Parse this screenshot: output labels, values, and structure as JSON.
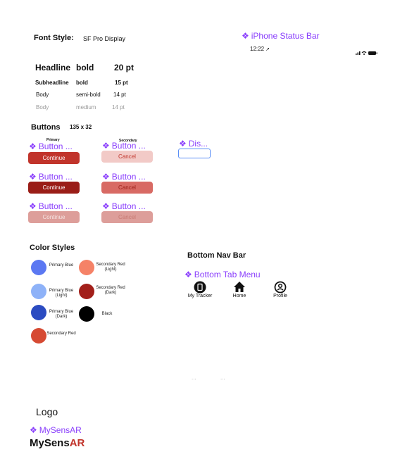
{
  "font_style": {
    "label": "Font Style:",
    "value": "SF Pro Display"
  },
  "status_bar": {
    "component": "iPhone Status Bar",
    "time": "12:22",
    "arrow": "➚"
  },
  "typography": {
    "header": {
      "name": "Headline",
      "weight": "bold",
      "size": "20 pt"
    },
    "rows": [
      {
        "name": "Subheadline",
        "weight": "bold",
        "size": "15 pt"
      },
      {
        "name": "Body",
        "weight": "semi-bold",
        "size": "14 pt"
      },
      {
        "name": "Body",
        "weight": "medium",
        "size": "14 pt"
      }
    ]
  },
  "buttons": {
    "title": "Buttons",
    "size": "135 x 32",
    "primary_label": "Primary",
    "secondary_label": "Secondary",
    "component_label": "Button ...",
    "disabled_component": "Dis...",
    "continue": "Continue",
    "cancel": "Cancel"
  },
  "colors": {
    "title": "Color Styles",
    "items": [
      {
        "name": "Primary Blue",
        "hex": "#5b78f2"
      },
      {
        "name": "Secondary Red (Light)",
        "hex": "#f58267"
      },
      {
        "name": "Primary Blue (Light)",
        "hex": "#8eb2f8"
      },
      {
        "name": "Secondary Red (Dark)",
        "hex": "#a21f1a"
      },
      {
        "name": "Primary Blue (Dark)",
        "hex": "#2b4bc1"
      },
      {
        "name": "Black",
        "hex": "#000000"
      },
      {
        "name": "Secondary Red",
        "hex": "#d64a33"
      }
    ]
  },
  "bottom_nav": {
    "title": "Bottom Nav Bar",
    "component": "Bottom Tab Menu",
    "items": [
      {
        "label": "My Tracker",
        "icon": "tracker-icon"
      },
      {
        "label": "Home",
        "icon": "home-icon"
      },
      {
        "label": "Profile",
        "icon": "profile-icon"
      }
    ]
  },
  "dots": {
    "left": "...",
    "right": "..."
  },
  "logo": {
    "title": "Logo",
    "component": "MySensAR",
    "text_main": "MySens",
    "text_accent": "AR"
  }
}
